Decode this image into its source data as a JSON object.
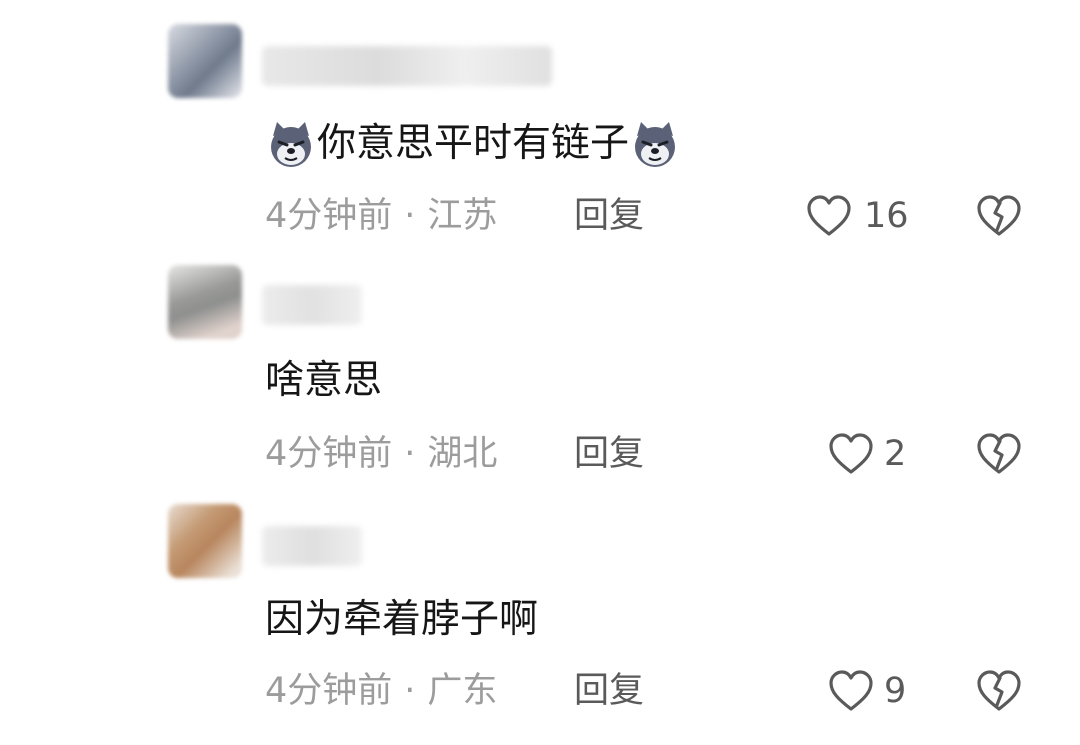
{
  "comments": [
    {
      "avatar_colors": [
        "#8a93a3",
        "#d8dbe2"
      ],
      "username_blur_color": "#e3e3e3",
      "content_text": "你意思平时有链子",
      "content_prefix_emoji": "wolf-emoji",
      "content_suffix_emoji": "wolf-emoji",
      "time": "4分钟前",
      "dot": "·",
      "location": "江苏",
      "reply_label": "回复",
      "like_count": "16"
    },
    {
      "avatar_colors": [
        "#9a9a98",
        "#e0d2cc"
      ],
      "username_blur_color": "#e8e8e8",
      "content_text": "啥意思",
      "time": "4分钟前",
      "dot": "·",
      "location": "湖北",
      "reply_label": "回复",
      "like_count": "2"
    },
    {
      "avatar_colors": [
        "#b8865e",
        "#e9ddd2"
      ],
      "username_blur_color": "#e6e6e6",
      "content_text": "因为牵着脖子啊",
      "time": "4分钟前",
      "dot": "·",
      "location": "广东",
      "reply_label": "回复",
      "like_count": "9"
    }
  ],
  "icons": {
    "like": "heart-outline-icon",
    "dislike": "broken-heart-icon"
  }
}
